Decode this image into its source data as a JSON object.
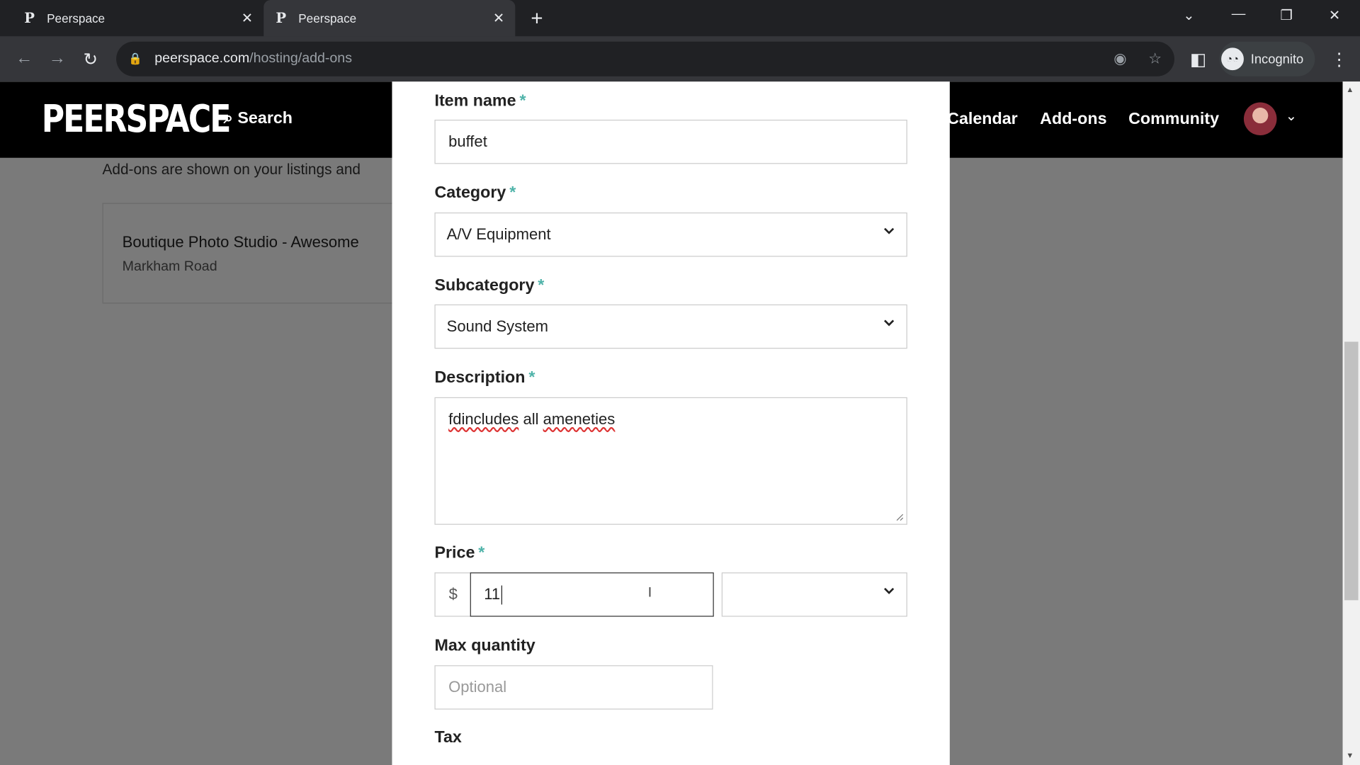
{
  "browser": {
    "tabs": [
      {
        "title": "Peerspace",
        "favicon": "P"
      },
      {
        "title": "Peerspace",
        "favicon": "P"
      }
    ],
    "url_host": "peerspace.com",
    "url_path": "/hosting/add-ons",
    "profile_label": "Incognito"
  },
  "site": {
    "logo": "PEERSPACE",
    "search_label": "Search",
    "nav": [
      "Calendar",
      "Add-ons",
      "Community"
    ],
    "subtext": "Add-ons are shown on your listings and",
    "listing": {
      "name": "Boutique Photo Studio - Awesome",
      "address": "Markham Road"
    }
  },
  "form": {
    "item_name": {
      "label": "Item name",
      "required": "*",
      "value": "buffet"
    },
    "category": {
      "label": "Category",
      "required": "*",
      "value": "A/V Equipment"
    },
    "subcategory": {
      "label": "Subcategory",
      "required": "*",
      "value": "Sound System"
    },
    "description": {
      "label": "Description",
      "required": "*",
      "misspelled1": "fdincludes",
      "mid": " all ",
      "misspelled2": "ameneties"
    },
    "price": {
      "label": "Price",
      "required": "*",
      "currency": "$",
      "value": "11",
      "unit": ""
    },
    "max_quantity": {
      "label": "Max quantity",
      "placeholder": "Optional"
    },
    "tax": {
      "label": "Tax"
    }
  },
  "colors": {
    "accent": "#4fb3a9",
    "header_bg": "#000000"
  }
}
